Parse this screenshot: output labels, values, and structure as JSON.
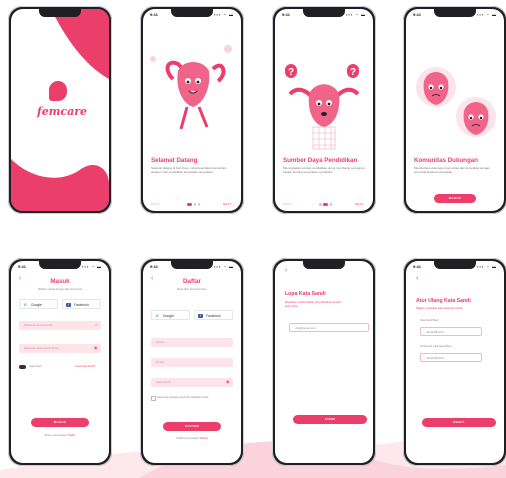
{
  "status": {
    "time": "9:41",
    "signal": "▪▪▪ ◔ ▬"
  },
  "splash": {
    "logo_text": "femcare"
  },
  "onboard1": {
    "title": "Selamat Datang",
    "body": "Selamat datang di FemCare, mitra kesehatan reproduksi wanita untuk pendidikan kesehatan reproduksi",
    "prev": "BACK",
    "next": "NEXT"
  },
  "onboard2": {
    "title": "Sumber Daya Pendidikan",
    "body": "Menyediakan sumber pendidikan untuk membantu pengguna belajar tentang kesehatan reproduksi",
    "prev": "BACK",
    "next": "NEXT"
  },
  "onboard3": {
    "title": "Komunitas Dukungan",
    "body": "Memberikan dukungan komunitas dan konsultasi dengan penyedia layanan kesehatan",
    "cta": "MASUK"
  },
  "login": {
    "title": "Masuk",
    "subtitle": "Silakan masuk dengan akun FemCare",
    "google": "Google",
    "facebook": "Facebook",
    "email_placeholder": "Masukan Email Anda",
    "password_placeholder": "Masukan kata sandi Anda",
    "remember": "Ingat Saya",
    "forgot": "Lupa Kata Sandi?",
    "submit": "MASUK",
    "no_account": "Belum punya akun?",
    "register_link": "Daftar"
  },
  "register": {
    "title": "Daftar",
    "subtitle": "Buat akun FemCare baru",
    "google": "Google",
    "facebook": "Facebook",
    "name_placeholder": "Nama",
    "email_placeholder": "Email",
    "password_placeholder": "Kata Sandi",
    "agree": "Saya setuju dengan syarat dan kebijakan privasi",
    "submit": "DAFTAR",
    "have_account": "Sudah punya akun?",
    "login_link": "Masuk"
  },
  "forgot": {
    "title": "Lupa Kata Sandi",
    "subtitle": "Masukkan email terdaftar yang ditautkan dengan akun Anda",
    "email_placeholder": "ulfa@gmail.com",
    "submit": "KIRIM"
  },
  "reset": {
    "title": "Atur Ulang Kata Sandi",
    "subtitle": "Silakan masukkan kata sandi baru Anda",
    "new_label": "Kata Sandi Baru",
    "new_value": "ulfa@#$1234",
    "confirm_label": "Konfirmasi Kata Sandi Baru",
    "confirm_value": "ulfa@#$1234",
    "submit": "RESET"
  },
  "colors": {
    "brand": "#ec3e6b",
    "soft": "#fde3ea"
  }
}
